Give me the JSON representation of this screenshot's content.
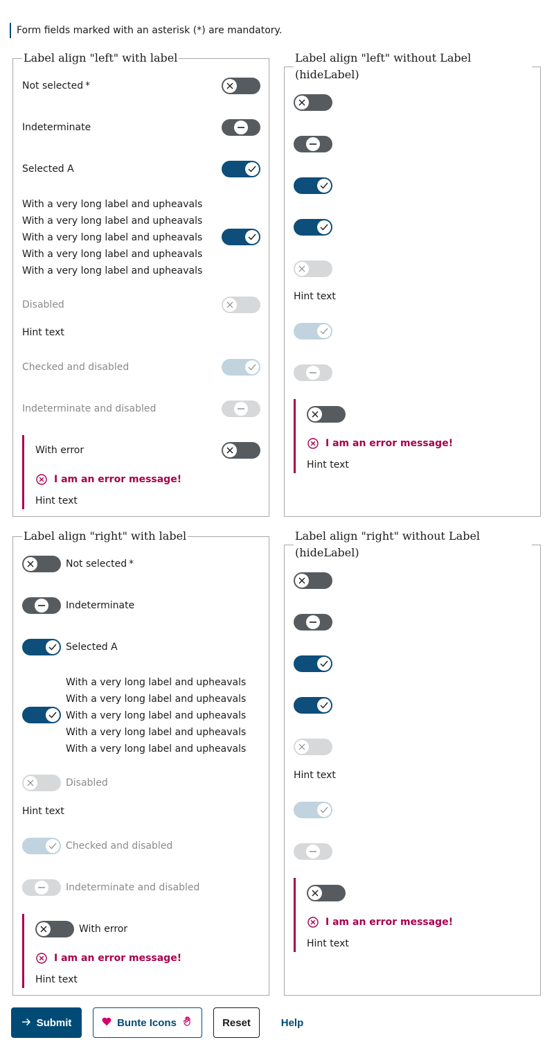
{
  "note": "Form fields marked with an asterisk (*) are mandatory.",
  "groups": {
    "left_with_label": {
      "legend": "Label align \"left\" with label",
      "labels": {
        "not_selected": "Not selected",
        "required_mark": "*",
        "indeterminate": "Indeterminate",
        "selected": "Selected A",
        "long": "With a very long label and upheavals With a very long label and upheavals With a very long label and upheavals With a very long label and upheavals With a very long label and upheavals",
        "disabled": "Disabled",
        "checked_disabled": "Checked and disabled",
        "indeterminate_disabled": "Indeterminate and disabled",
        "with_error": "With error"
      },
      "hint": "Hint text",
      "error": "I am an error message!",
      "error_hint": "Hint text"
    },
    "left_hidden_label": {
      "legend": "Label align \"left\" without Label (hideLabel)",
      "hint": "Hint text",
      "error": "I am an error message!",
      "error_hint": "Hint text"
    },
    "right_with_label": {
      "legend": "Label align \"right\" with label",
      "labels": {
        "not_selected": "Not selected",
        "required_mark": "*",
        "indeterminate": "Indeterminate",
        "selected": "Selected A",
        "long": "With a very long label and upheavals With a very long label and upheavals With a very long label and upheavals With a very long label and upheavals With a very long label and upheavals",
        "disabled": "Disabled",
        "checked_disabled": "Checked and disabled",
        "indeterminate_disabled": "Indeterminate and disabled",
        "with_error": "With error"
      },
      "hint": "Hint text",
      "error": "I am an error message!",
      "error_hint": "Hint text"
    },
    "right_hidden_label": {
      "legend": "Label align \"right\" without Label (hideLabel)",
      "hint": "Hint text",
      "error": "I am an error message!",
      "error_hint": "Hint text"
    }
  },
  "buttons": {
    "submit": "Submit",
    "bunte": "Bunte Icons",
    "reset": "Reset",
    "help": "Help"
  },
  "colors": {
    "primary": "#004b76",
    "error": "#a7004e",
    "switch_off": "#565b5f",
    "switch_on": "#0d4e7a"
  },
  "icons": {
    "off": "close-icon",
    "indeterminate": "minus-icon",
    "on": "check-icon",
    "submit": "arrow-right-icon",
    "bunte_left": "heart-icon",
    "bunte_right": "hand-icon"
  }
}
